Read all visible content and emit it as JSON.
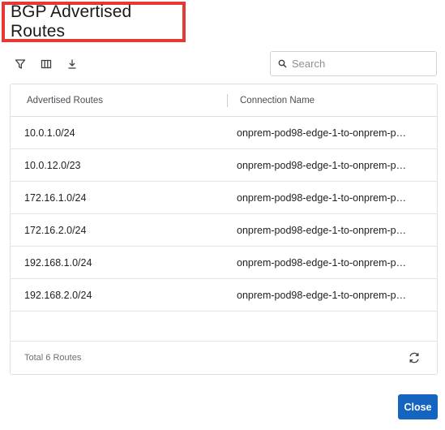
{
  "dialog": {
    "title": "BGP Advertised Routes",
    "highlight_color": "#e53935"
  },
  "toolbar": {
    "icons": [
      "filter-icon",
      "columns-icon",
      "download-icon"
    ]
  },
  "search": {
    "placeholder": "Search"
  },
  "table": {
    "columns": [
      "Advertised Routes",
      "Connection Name"
    ],
    "rows": [
      {
        "route": "10.0.1.0/24",
        "connection": "onprem-pod98-edge-1-to-onprem-p…"
      },
      {
        "route": "10.0.12.0/23",
        "connection": "onprem-pod98-edge-1-to-onprem-p…"
      },
      {
        "route": "172.16.1.0/24",
        "connection": "onprem-pod98-edge-1-to-onprem-p…"
      },
      {
        "route": "172.16.2.0/24",
        "connection": "onprem-pod98-edge-1-to-onprem-p…"
      },
      {
        "route": "192.168.1.0/24",
        "connection": "onprem-pod98-edge-1-to-onprem-p…"
      },
      {
        "route": "192.168.2.0/24",
        "connection": "onprem-pod98-edge-1-to-onprem-p…"
      }
    ],
    "total_label": "Total 6 Routes"
  },
  "footer": {
    "close_label": "Close",
    "accent": "#1565c0"
  }
}
